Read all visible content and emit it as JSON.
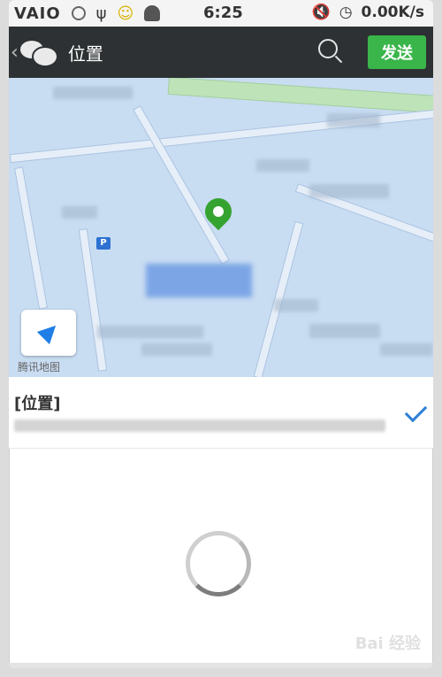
{
  "statusbar": {
    "time": "6:25",
    "network_speed": "0.00K/s",
    "left_icons": [
      "vaio-icon",
      "target-icon",
      "usb-icon",
      "smiley-icon",
      "android-icon"
    ],
    "right_icons": [
      "mute-icon",
      "alarm-icon"
    ]
  },
  "header": {
    "title": "位置",
    "send_label": "发送"
  },
  "map": {
    "attribution": "腾讯地图",
    "pin_color": "#35a32f",
    "parking_label": "P"
  },
  "location": {
    "name": "[位置]",
    "address": "",
    "selected": true
  },
  "watermark": "Bai 经验"
}
